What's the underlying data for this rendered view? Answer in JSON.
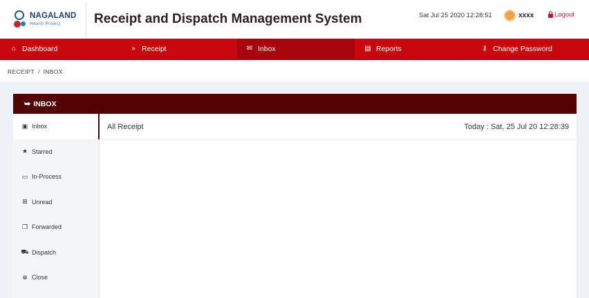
{
  "brand": {
    "name": "NAGALAND",
    "subtitle": "Health Project"
  },
  "header": {
    "title": "Receipt and Dispatch Management System",
    "datetime": "Sat Jul 25 2020 12:28:51",
    "username": "xxxx",
    "logout_label": "Logout"
  },
  "nav": {
    "items": [
      {
        "label": "Dashboard",
        "icon": "home-icon"
      },
      {
        "label": "Receipt",
        "icon": "chevron-double-down-icon"
      },
      {
        "label": "Inbox",
        "icon": "envelope-icon"
      },
      {
        "label": "Reports",
        "icon": "document-icon"
      },
      {
        "label": "Change Password",
        "icon": "key-icon"
      }
    ],
    "active": "Inbox"
  },
  "breadcrumb": {
    "items": [
      "RECEIPT",
      "INBOX"
    ],
    "separator": "/"
  },
  "panel": {
    "title": "INBOX",
    "sidebar": [
      {
        "label": "Inbox",
        "icon": "inbox-icon"
      },
      {
        "label": "Starred",
        "icon": "star-icon"
      },
      {
        "label": "In-Process",
        "icon": "comment-icon"
      },
      {
        "label": "Unread",
        "icon": "sitemap-icon"
      },
      {
        "label": "Forwarded",
        "icon": "copy-icon"
      },
      {
        "label": "Dispatch",
        "icon": "truck-icon"
      },
      {
        "label": "Close",
        "icon": "times-circle-icon"
      }
    ],
    "content_title": "All Receipt",
    "today": "Today : Sat, 25 Jul 20 12:28:39"
  },
  "colors": {
    "nav_red": "#c8070f",
    "panel_header": "#530303",
    "logout": "#c8102e"
  }
}
